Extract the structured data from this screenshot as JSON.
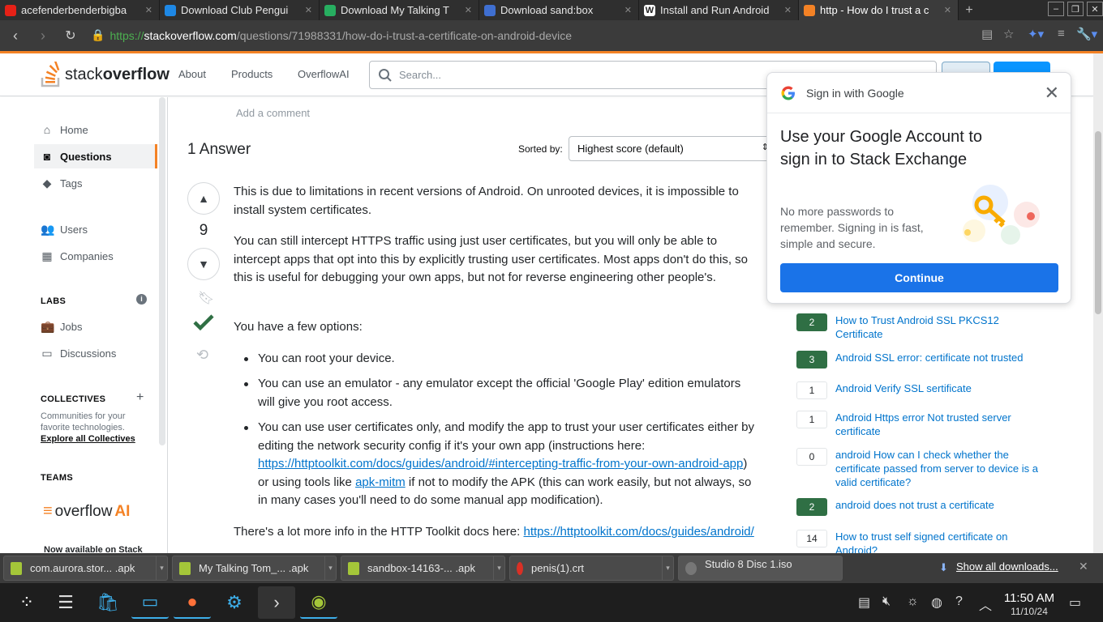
{
  "browser": {
    "tabs": [
      {
        "title": "acefenderbenderbigba",
        "favicon": "youtube-icon",
        "color": "#e62117"
      },
      {
        "title": "Download Club Pengui",
        "favicon": "penguin-icon",
        "color": "#1e88e5"
      },
      {
        "title": "Download My Talking T",
        "favicon": "aptoide-icon",
        "color": "#27ae60"
      },
      {
        "title": "Download sand:box",
        "favicon": "gamepad-icon",
        "color": "#3f6fd1"
      },
      {
        "title": "Install and Run Android",
        "favicon": "w-icon",
        "color": "#222222"
      },
      {
        "title": "http - How do I trust a c",
        "favicon": "stackoverflow-icon",
        "color": "#f48225"
      }
    ],
    "url": {
      "scheme": "https://",
      "host": "stackoverflow.com",
      "path": "/questions/71988331/how-do-i-trust-a-certificate-on-android-device"
    }
  },
  "header": {
    "logo_text_regular": "stack",
    "logo_text_bold": "overflow",
    "nav": [
      "About",
      "Products",
      "OverflowAI"
    ],
    "search_placeholder": "Search..."
  },
  "sidebar": {
    "items": [
      {
        "label": "Home",
        "icon": "home-icon"
      },
      {
        "label": "Questions",
        "icon": "questions-icon",
        "selected": true
      },
      {
        "label": "Tags",
        "icon": "tag-icon"
      },
      {
        "label": "Users",
        "icon": "users-icon"
      },
      {
        "label": "Companies",
        "icon": "companies-icon"
      }
    ],
    "labs_title": "LABS",
    "labs_items": [
      {
        "label": "Jobs",
        "icon": "briefcase-icon"
      },
      {
        "label": "Discussions",
        "icon": "discussions-icon"
      }
    ],
    "collectives_title": "COLLECTIVES",
    "collectives_desc": "Communities for your favorite technologies.",
    "collectives_link": "Explore all Collectives",
    "teams_title": "TEAMS",
    "teams_logo": "overflow",
    "teams_logo_ai": "AI",
    "teams_now": "Now available on Stack"
  },
  "answer": {
    "add_comment": "Add a comment",
    "count_label": "1 Answer",
    "sorted_by": "Sorted by:",
    "sort_value": "Highest score (default)",
    "votes": "9",
    "p1": "This is due to limitations in recent versions of Android. On unrooted devices, it is impossible to install system certificates.",
    "p2": "You can still intercept HTTPS traffic using just user certificates, but you will only be able to intercept apps that opt into this by explicitly trusting user certificates. Most apps don't do this, so this is useful for debugging your own apps, but not for reverse engineering other people's.",
    "p3": "You have a few options:",
    "li1": "You can root your device.",
    "li2": "You can use an emulator - any emulator except the official 'Google Play' edition emulators will give you root access.",
    "li3_a": "You can use user certificates only, and modify the app to trust your user certificates either by editing the network security config if it's your own app (instructions here: ",
    "li3_link1": "https://httptoolkit.com/docs/guides/android/#intercepting-traffic-from-your-own-android-app",
    "li3_b": ") or using tools like ",
    "li3_link2": "apk-mitm",
    "li3_c": " if not to modify the APK (this can work easily, but not always, so in many cases you'll need to do some manual app modification).",
    "p4": "There's a lot more info in the HTTP Toolkit docs here: ",
    "p4_link": "https://httptoolkit.com/docs/guides/android/"
  },
  "google_popup": {
    "header": "Sign in with Google",
    "title": "Use your Google Account to sign in to Stack Exchange",
    "desc": "No more passwords to remember. Signing in is fast, simple and secure.",
    "button": "Continue"
  },
  "related": [
    {
      "count": "2",
      "accepted": true,
      "title": "How to Trust Android SSL PKCS12 Certificate"
    },
    {
      "count": "3",
      "accepted": true,
      "title": "Android SSL error: certificate not trusted"
    },
    {
      "count": "1",
      "accepted": false,
      "title": "Android Verify SSL sertificate"
    },
    {
      "count": "1",
      "accepted": false,
      "title": "Android Https error Not trusted server certificate"
    },
    {
      "count": "0",
      "accepted": false,
      "title": "android How can I check whether the certificate passed from server to device is a valid certificate?"
    },
    {
      "count": "2",
      "accepted": true,
      "title": "android does not trust a certificate"
    },
    {
      "count": "14",
      "accepted": false,
      "title": "How to trust self signed certificate on Android?"
    }
  ],
  "downloads": {
    "items": [
      {
        "name": "com.aurora.stor... .apk",
        "icon": "apk-icon",
        "color": "#a4c639"
      },
      {
        "name": "My Talking Tom_... .apk",
        "icon": "apk-icon",
        "color": "#a4c639"
      },
      {
        "name": "sandbox-14163-... .apk",
        "icon": "apk-icon",
        "color": "#a4c639"
      },
      {
        "name": "penis(1).crt",
        "icon": "certificate-icon",
        "color": "#d93025"
      },
      {
        "name": "Studio 8 Disc 1.iso",
        "icon": "disc-icon",
        "color": "#777777"
      }
    ],
    "show_all": "Show all downloads..."
  },
  "taskbar": {
    "time": "11:50 AM",
    "date": "11/10/24"
  }
}
